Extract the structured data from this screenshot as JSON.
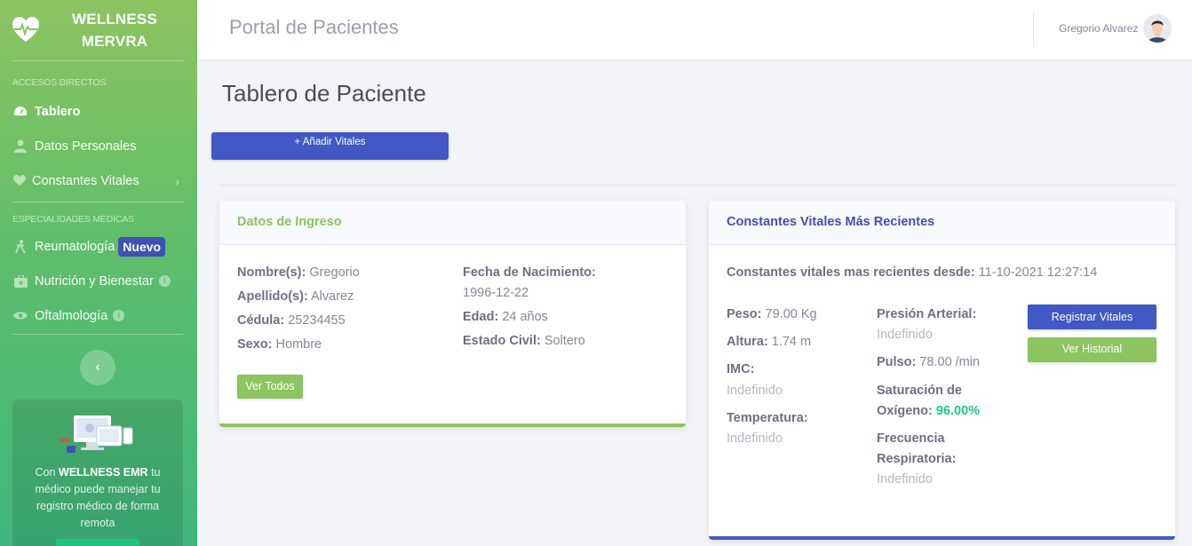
{
  "brand": {
    "line1": "WELLNESS",
    "line2": "MERVRA"
  },
  "sidebar": {
    "heading1": "ACCESOS DIRECTOS",
    "items1": [
      {
        "label": "Tablero",
        "icon": "dashboard-icon"
      },
      {
        "label": "Datos Personales",
        "icon": "user-icon"
      },
      {
        "label": "Constantes Vitales",
        "icon": "heart-icon"
      }
    ],
    "heading2": "ESPECIALIDADES MÉDICAS",
    "items2": [
      {
        "label": "Reumatología",
        "badge": "Nuevo",
        "icon": "walking-icon"
      },
      {
        "label": "Nutrición y Bienestar",
        "icon": "medkit-icon"
      },
      {
        "label": "Oftalmología",
        "icon": "eye-icon"
      }
    ],
    "toggle": "‹",
    "promo": {
      "pre": "Con ",
      "bold": "WELLNESS EMR",
      "post": " tu médico puede manejar tu registro médico de forma remota"
    }
  },
  "topbar": {
    "title": "Portal de Pacientes",
    "user": "Gregorio Alvarez"
  },
  "main": {
    "title": "Tablero de Paciente",
    "add_button": "+ Añadir Vitales"
  },
  "ingreso": {
    "header": "Datos de Ingreso",
    "nombre_label": "Nombre(s):",
    "nombre": "Gregorio",
    "apellido_label": "Apellido(s):",
    "apellido": "Alvarez",
    "cedula_label": "Cédula:",
    "cedula": "25234455",
    "sexo_label": "Sexo:",
    "sexo": "Hombre",
    "fecha_label": "Fecha de Nacimiento:",
    "fecha": "1996-12-22",
    "edad_label": "Edad:",
    "edad": "24 años",
    "estado_label": "Estado Civil:",
    "estado": "Soltero",
    "ver_todos": "Ver Todos"
  },
  "vitales": {
    "header": "Constantes Vitales Más Recientes",
    "desde_label": "Constantes vitales mas recientes desde:",
    "desde": "11-10-2021 12:27:14",
    "peso_label": "Peso:",
    "peso": "79.00 Kg",
    "altura_label": "Altura:",
    "altura": "1.74 m",
    "imc_label": "IMC:",
    "imc": "Indefinido",
    "temp_label": "Temperatura:",
    "temp": "Indefinido",
    "presion_label": "Presión Arterial:",
    "presion": "Indefinido",
    "pulso_label": "Pulso:",
    "pulso": "78.00 /min",
    "sat_label1": "Saturación de",
    "sat_label2": "Oxígeno:",
    "sat": "96.00%",
    "frec_label1": "Frecuencia",
    "frec_label2": "Respiratoria:",
    "frec": "Indefinido",
    "btn_registrar": "Registrar Vitales",
    "btn_historial": "Ver Historial"
  },
  "colors": {
    "green": "#8cc460",
    "blue": "#4258c4",
    "success": "#1cc88a"
  }
}
